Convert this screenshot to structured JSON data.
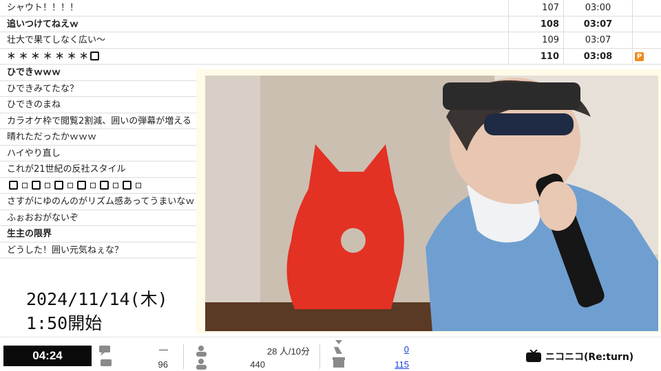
{
  "comments": [
    {
      "text": "シャウト！！！！",
      "no": "107",
      "time": "03:00",
      "bold": false
    },
    {
      "text": "追いつけてねえｗ",
      "no": "108",
      "time": "03:07",
      "bold": true
    },
    {
      "text": "壮大で果てしなく広い～",
      "no": "109",
      "time": "03:07",
      "bold": false
    },
    {
      "text": "＊ ＊ ＊ ＊ ＊ ＊ ＊",
      "no": "110",
      "time": "03:08",
      "bold": true,
      "premium": "P"
    },
    {
      "text": "ひできｗｗｗ",
      "bold": true
    },
    {
      "text": "ひできみてたな？",
      "bold": false
    },
    {
      "text": "ひできのまね",
      "bold": false
    },
    {
      "text": "カラオケ枠で閲覧2割減、囲いの弾幕が増える",
      "bold": false
    },
    {
      "text": "晴れただったかｗｗｗ",
      "bold": false
    },
    {
      "text": "ハイやり直し",
      "bold": false
    },
    {
      "text": "これが21世紀の反社スタイル",
      "bold": false
    },
    {
      "text": "",
      "bold": false,
      "boxes": true
    },
    {
      "text": "さすがにゆのんのがリズム感あってうまいなｗ",
      "bold": false
    },
    {
      "text": "ふぉおおがないぞ",
      "bold": false
    },
    {
      "text": "生主の限界",
      "bold": true
    },
    {
      "text": "どうした！囲い元気ねぇな？",
      "bold": false
    }
  ],
  "overlay": {
    "date": "2024/11/14(木)",
    "start": "1:50開始"
  },
  "status": {
    "elapsed": "04:24",
    "comment_rate": "—",
    "comment_total": "96",
    "viewers_rate": "28 人/10分",
    "viewers_total": "440",
    "ad_points": "0",
    "gift_points": "115"
  },
  "brand": {
    "name": "ニコニコ(Re:turn)"
  },
  "colors": {
    "accent_link": "#1a3fd6",
    "premium_badge": "#f08a1c",
    "elapsed_bg": "#0a0a0a"
  }
}
